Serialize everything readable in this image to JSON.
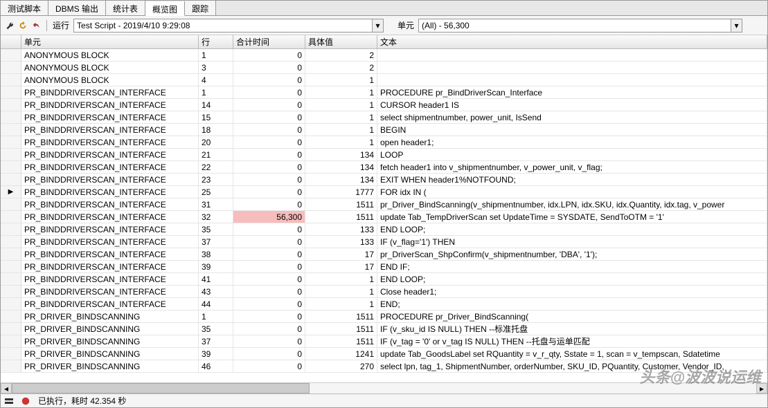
{
  "tabs": [
    "测试脚本",
    "DBMS 输出",
    "统计表",
    "概览图",
    "跟踪"
  ],
  "active_tab": 3,
  "toolbar": {
    "run_label": "运行",
    "run_value": "Test Script - 2019/4/10 9:29:08",
    "unit_label": "单元",
    "unit_value": "(All) - 56,300"
  },
  "columns": {
    "unit": "单元",
    "line": "行",
    "total": "合计时间",
    "val": "具体值",
    "text": "文本"
  },
  "rows": [
    {
      "unit": "ANONYMOUS BLOCK",
      "line": "1",
      "total": "0",
      "val": "2",
      "text": "",
      "ind": ""
    },
    {
      "unit": "ANONYMOUS BLOCK",
      "line": "3",
      "total": "0",
      "val": "2",
      "text": "",
      "ind": ""
    },
    {
      "unit": "ANONYMOUS BLOCK",
      "line": "4",
      "total": "0",
      "val": "1",
      "text": "",
      "ind": ""
    },
    {
      "unit": "PR_BINDDRIVERSCAN_INTERFACE",
      "line": "1",
      "total": "0",
      "val": "1",
      "text": "PROCEDURE pr_BindDriverScan_Interface",
      "ind": ""
    },
    {
      "unit": "PR_BINDDRIVERSCAN_INTERFACE",
      "line": "14",
      "total": "0",
      "val": "1",
      "text": "CURSOR header1 IS",
      "ind": ""
    },
    {
      "unit": "PR_BINDDRIVERSCAN_INTERFACE",
      "line": "15",
      "total": "0",
      "val": "1",
      "text": "select shipmentnumber, power_unit, IsSend",
      "ind": ""
    },
    {
      "unit": "PR_BINDDRIVERSCAN_INTERFACE",
      "line": "18",
      "total": "0",
      "val": "1",
      "text": "BEGIN",
      "ind": ""
    },
    {
      "unit": "PR_BINDDRIVERSCAN_INTERFACE",
      "line": "20",
      "total": "0",
      "val": "1",
      "text": "open header1;",
      "ind": ""
    },
    {
      "unit": "PR_BINDDRIVERSCAN_INTERFACE",
      "line": "21",
      "total": "0",
      "val": "134",
      "text": "LOOP",
      "ind": ""
    },
    {
      "unit": "PR_BINDDRIVERSCAN_INTERFACE",
      "line": "22",
      "total": "0",
      "val": "134",
      "text": "fetch header1 into v_shipmentnumber, v_power_unit, v_flag;",
      "ind": ""
    },
    {
      "unit": "PR_BINDDRIVERSCAN_INTERFACE",
      "line": "23",
      "total": "0",
      "val": "134",
      "text": "EXIT WHEN header1%NOTFOUND;",
      "ind": ""
    },
    {
      "unit": "PR_BINDDRIVERSCAN_INTERFACE",
      "line": "25",
      "total": "0",
      "val": "1777",
      "text": "FOR idx IN (",
      "ind": "▶"
    },
    {
      "unit": "PR_BINDDRIVERSCAN_INTERFACE",
      "line": "31",
      "total": "0",
      "val": "1511",
      "text": "pr_Driver_BindScanning(v_shipmentnumber, idx.LPN, idx.SKU, idx.Quantity, idx.tag, v_power",
      "ind": ""
    },
    {
      "unit": "PR_BINDDRIVERSCAN_INTERFACE",
      "line": "32",
      "total": "56,300",
      "val": "1511",
      "text": "update Tab_TempDriverScan set UpdateTime = SYSDATE, SendToOTM = '1'",
      "ind": "",
      "hl": true
    },
    {
      "unit": "PR_BINDDRIVERSCAN_INTERFACE",
      "line": "35",
      "total": "0",
      "val": "133",
      "text": "END LOOP;",
      "ind": ""
    },
    {
      "unit": "PR_BINDDRIVERSCAN_INTERFACE",
      "line": "37",
      "total": "0",
      "val": "133",
      "text": "IF (v_flag='1') THEN",
      "ind": ""
    },
    {
      "unit": "PR_BINDDRIVERSCAN_INTERFACE",
      "line": "38",
      "total": "0",
      "val": "17",
      "text": "pr_DriverScan_ShpConfirm(v_shipmentnumber, 'DBA', '1');",
      "ind": ""
    },
    {
      "unit": "PR_BINDDRIVERSCAN_INTERFACE",
      "line": "39",
      "total": "0",
      "val": "17",
      "text": "END IF;",
      "ind": ""
    },
    {
      "unit": "PR_BINDDRIVERSCAN_INTERFACE",
      "line": "41",
      "total": "0",
      "val": "1",
      "text": "END LOOP;",
      "ind": ""
    },
    {
      "unit": "PR_BINDDRIVERSCAN_INTERFACE",
      "line": "43",
      "total": "0",
      "val": "1",
      "text": "Close header1;",
      "ind": ""
    },
    {
      "unit": "PR_BINDDRIVERSCAN_INTERFACE",
      "line": "44",
      "total": "0",
      "val": "1",
      "text": "END;",
      "ind": ""
    },
    {
      "unit": "PR_DRIVER_BINDSCANNING",
      "line": "1",
      "total": "0",
      "val": "1511",
      "text": "PROCEDURE pr_Driver_BindScanning(",
      "ind": ""
    },
    {
      "unit": "PR_DRIVER_BINDSCANNING",
      "line": "35",
      "total": "0",
      "val": "1511",
      "text": "IF (v_sku_id IS NULL) THEN   --标准托盘",
      "ind": ""
    },
    {
      "unit": "PR_DRIVER_BINDSCANNING",
      "line": "37",
      "total": "0",
      "val": "1511",
      "text": "IF (v_tag = '0' or v_tag IS NULL) THEN   --托盘与运单匹配",
      "ind": ""
    },
    {
      "unit": "PR_DRIVER_BINDSCANNING",
      "line": "39",
      "total": "0",
      "val": "1241",
      "text": "update Tab_GoodsLabel set RQuantity = v_r_qty, Sstate = 1, scan = v_tempscan, Sdatetime",
      "ind": ""
    },
    {
      "unit": "PR_DRIVER_BINDSCANNING",
      "line": "46",
      "total": "0",
      "val": "270",
      "text": "select lpn, tag_1, ShipmentNumber, orderNumber, SKU_ID, PQuantity, Customer, Vendor_ID,",
      "ind": ""
    }
  ],
  "status": "已执行，耗时 42.354 秒",
  "watermark": "头条@波波说运维"
}
